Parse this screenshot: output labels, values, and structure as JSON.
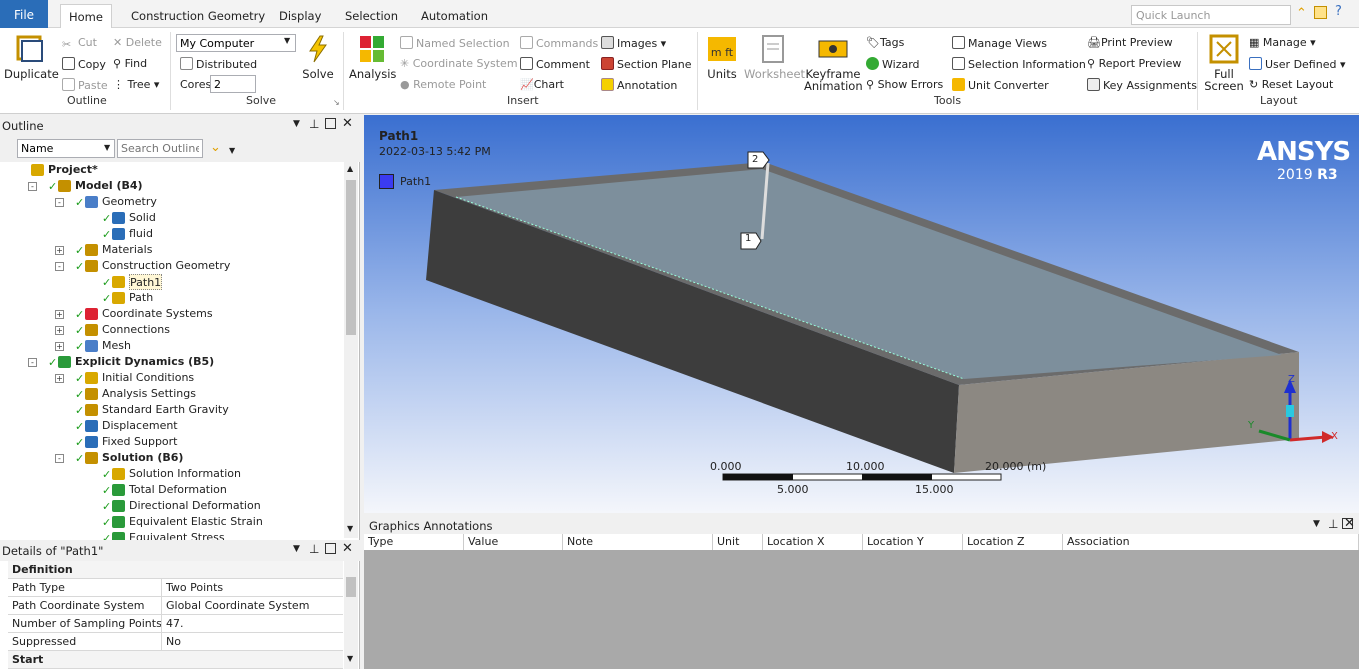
{
  "tabs": {
    "file": "File",
    "items": [
      "Home",
      "Construction Geometry",
      "Display",
      "Selection",
      "Automation"
    ],
    "active": "Home"
  },
  "quick_launch": {
    "placeholder": "Quick Launch"
  },
  "ribbon": {
    "outline": {
      "label": "Outline",
      "duplicate": "Duplicate",
      "cut": "Cut",
      "delete": "Delete",
      "copy": "Copy",
      "find": "Find",
      "paste": "Paste",
      "tree": "Tree"
    },
    "solve": {
      "label": "Solve",
      "machine": "My Computer",
      "distributed": "Distributed",
      "cores_label": "Cores",
      "cores_value": "2",
      "solve_button": "Solve"
    },
    "insert": {
      "label": "Insert",
      "analysis": "Analysis",
      "named_selection": "Named Selection",
      "coordinate_system": "Coordinate System",
      "remote_point": "Remote Point",
      "commands": "Commands",
      "comment": "Comment",
      "chart": "Chart",
      "images": "Images",
      "section_plane": "Section Plane",
      "annotation": "Annotation"
    },
    "tools": {
      "label": "Tools",
      "units": "Units",
      "worksheet": "Worksheet",
      "keyframe": "Keyframe",
      "animation": "Animation",
      "tags": "Tags",
      "wizard": "Wizard",
      "show_errors": "Show Errors",
      "manage_views": "Manage Views",
      "selection_information": "Selection Information",
      "unit_converter": "Unit Converter",
      "print_preview": "Print Preview",
      "report_preview": "Report Preview",
      "key_assignments": "Key Assignments"
    },
    "layout": {
      "label": "Layout",
      "full": "Full",
      "screen": "Screen",
      "manage": "Manage",
      "user_defined": "User Defined",
      "reset_layout": "Reset Layout"
    }
  },
  "outline": {
    "title": "Outline",
    "filter_select": "Name",
    "search_placeholder": "Search Outline",
    "tree": [
      {
        "label": "Project*",
        "bold": true
      },
      {
        "label": "Model (B4)",
        "bold": true
      },
      {
        "label": "Geometry"
      },
      {
        "label": "Solid"
      },
      {
        "label": "fluid"
      },
      {
        "label": "Materials"
      },
      {
        "label": "Construction Geometry"
      },
      {
        "label": "Path1"
      },
      {
        "label": "Path"
      },
      {
        "label": "Coordinate Systems"
      },
      {
        "label": "Connections"
      },
      {
        "label": "Mesh"
      },
      {
        "label": "Explicit Dynamics (B5)",
        "bold": true
      },
      {
        "label": "Initial Conditions"
      },
      {
        "label": "Analysis Settings"
      },
      {
        "label": "Standard Earth Gravity"
      },
      {
        "label": "Displacement"
      },
      {
        "label": "Fixed Support"
      },
      {
        "label": "Solution (B6)",
        "bold": true
      },
      {
        "label": "Solution Information"
      },
      {
        "label": "Total Deformation"
      },
      {
        "label": "Directional Deformation"
      },
      {
        "label": "Equivalent Elastic Strain"
      },
      {
        "label": "Equivalent Stress"
      }
    ]
  },
  "details": {
    "title": "Details of \"Path1\"",
    "rows": [
      {
        "k": "Definition",
        "v": "",
        "header": true
      },
      {
        "k": "Path Type",
        "v": "Two Points"
      },
      {
        "k": "Path Coordinate System",
        "v": "Global Coordinate System"
      },
      {
        "k": "Number of Sampling Points",
        "v": "47."
      },
      {
        "k": "Suppressed",
        "v": "No"
      },
      {
        "k": "Start",
        "v": "",
        "header": true
      }
    ]
  },
  "viewport": {
    "title": "Path1",
    "timestamp": "2022-03-13 5:42 PM",
    "legend": "Path1",
    "brand": "ANSYS",
    "version": "2019",
    "release": "R3",
    "point1": "1",
    "point2": "2",
    "scale_top": [
      "0.000",
      "10.000",
      "20.000 (m)"
    ],
    "scale_bottom": [
      "5.000",
      "15.000"
    ],
    "axes": {
      "x": "X",
      "y": "Y",
      "z": "Z"
    }
  },
  "annotations": {
    "title": "Graphics Annotations",
    "columns": [
      "Type",
      "Value",
      "Note",
      "Unit",
      "Location X",
      "Location Y",
      "Location Z",
      "Association"
    ]
  }
}
